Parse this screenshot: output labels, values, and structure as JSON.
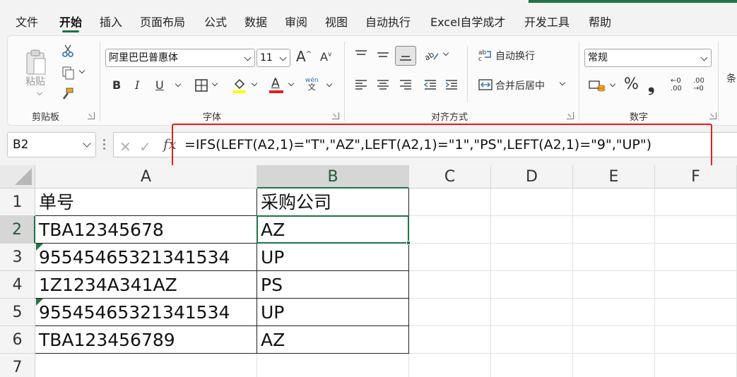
{
  "ribbon_tabs": {
    "file": "文件",
    "home": "开始",
    "insert": "插入",
    "page_layout": "页面布局",
    "formulas": "公式",
    "data": "数据",
    "review": "审阅",
    "view": "视图",
    "automate": "自动执行",
    "excel_learning": "Excel自学成才",
    "developer": "开发工具",
    "help": "帮助"
  },
  "clipboard": {
    "paste_label": "粘贴",
    "group_label": "剪贴板"
  },
  "font": {
    "name": "阿里巴巴普惠体",
    "size": "11",
    "grow": "A",
    "shrink": "A",
    "bold": "B",
    "italic": "I",
    "underline": "U",
    "font_color_glyph": "A",
    "phonetic_top": "wén",
    "phonetic_bottom": "文",
    "group_label": "字体",
    "fill_color": "#ffff00",
    "font_color": "#e02020"
  },
  "alignment": {
    "wrap_text": "自动换行",
    "merge_center": "合并后居中",
    "group_label": "对齐方式"
  },
  "number": {
    "format": "常规",
    "percent": "%",
    "comma": "❟",
    "inc_decimal_top": "←0",
    "inc_decimal_bottom": ".00",
    "dec_decimal_top": ".00",
    "dec_decimal_bottom": "→0",
    "group_label": "数字"
  },
  "styles": {
    "partial_label": "条"
  },
  "formula_bar": {
    "name_box": "B2",
    "fx": "fx",
    "cancel": "✕",
    "confirm": "✓",
    "formula": "=IFS(LEFT(A2,1)=\"T\",\"AZ\",LEFT(A2,1)=\"1\",\"PS\",LEFT(A2,1)=\"9\",\"UP\")"
  },
  "sheet": {
    "columns": [
      "A",
      "B",
      "C",
      "D",
      "E",
      "F"
    ],
    "rows": [
      "1",
      "2",
      "3",
      "4",
      "5",
      "6",
      "7"
    ],
    "cells": [
      [
        "单号",
        "采购公司"
      ],
      [
        "TBA12345678",
        "AZ"
      ],
      [
        "95545465321341534",
        "UP"
      ],
      [
        "1Z1234A341AZ",
        "PS"
      ],
      [
        "95545465321341534",
        "UP"
      ],
      [
        "TBA123456789",
        "AZ"
      ]
    ],
    "active_cell": "B2",
    "accent_color": "#217346",
    "highlight_box_color": "#e02020"
  }
}
